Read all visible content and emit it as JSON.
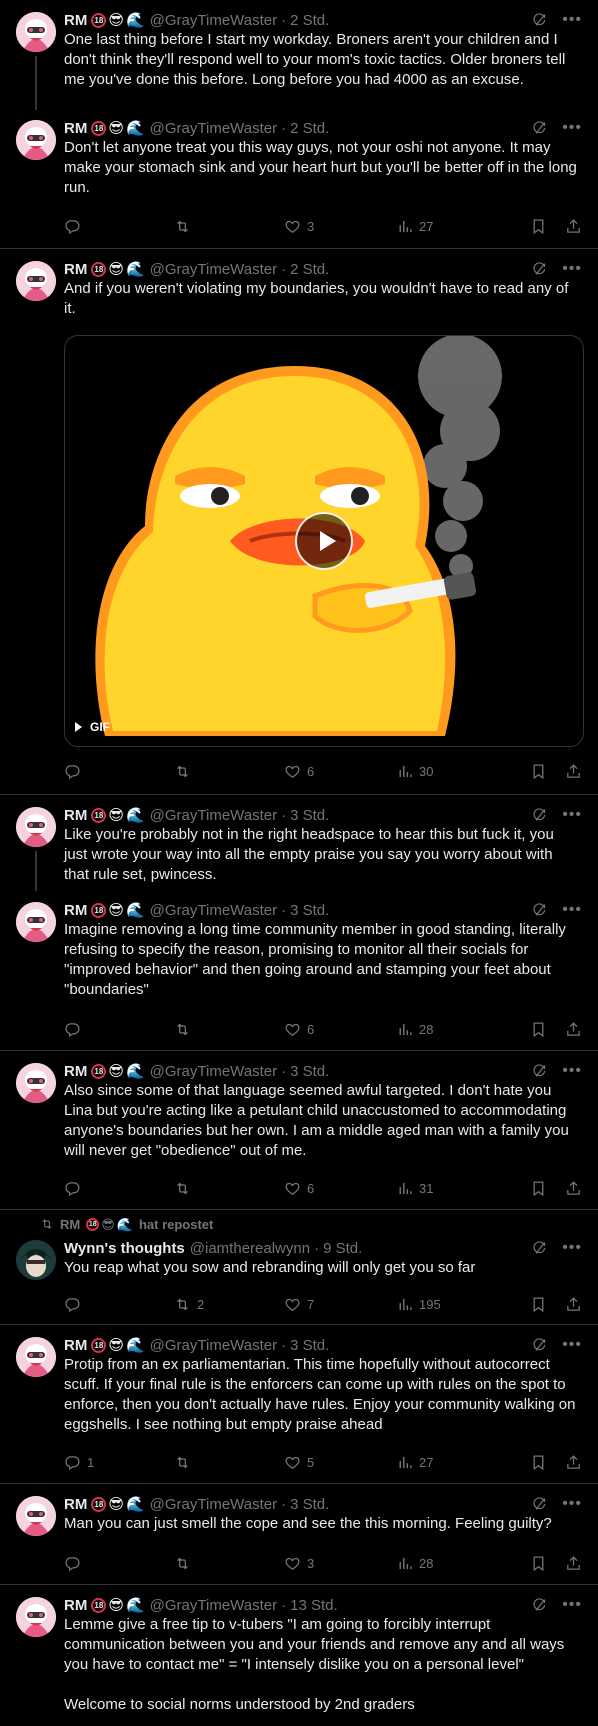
{
  "colors": {
    "background": "#000000",
    "text": "#e7e9ea",
    "muted": "#71767b",
    "border": "#2f3336",
    "accent": "#1d9bf0"
  },
  "icons": {
    "reply": "reply-icon",
    "repost": "repost-icon",
    "like": "heart-icon",
    "views": "views-icon",
    "bookmark": "bookmark-icon",
    "share": "share-icon",
    "grok": "grok-icon",
    "more": "more-icon"
  },
  "tweets": [
    {
      "name": "RM",
      "badges": [
        "18",
        "😎",
        "🌊"
      ],
      "handle": "@GrayTimeWaster",
      "time": "2 Std.",
      "text": "One last thing before I start my workday. Broners aren't your children and I don't think they'll respond well to your mom's toxic tactics. Older broners tell me you've done this before. Long before you had 4000 as an excuse."
    },
    {
      "name": "RM",
      "badges": [
        "18",
        "😎",
        "🌊"
      ],
      "handle": "@GrayTimeWaster",
      "time": "2 Std.",
      "text": "Don't let anyone treat you this way guys, not your oshi not anyone. It may make your stomach sink and your heart hurt but you'll be better off in the long run.",
      "stats": {
        "replies": "",
        "reposts": "",
        "likes": "3",
        "views": "27"
      }
    },
    {
      "name": "RM",
      "badges": [
        "18",
        "😎",
        "🌊"
      ],
      "handle": "@GrayTimeWaster",
      "time": "2 Std.",
      "text": "And if you weren't violating my boundaries, you wouldn't have to read any of it.",
      "media": {
        "type": "GIF",
        "label": "GIF"
      },
      "stats": {
        "replies": "",
        "reposts": "",
        "likes": "6",
        "views": "30"
      }
    },
    {
      "name": "RM",
      "badges": [
        "18",
        "😎",
        "🌊"
      ],
      "handle": "@GrayTimeWaster",
      "time": "3 Std.",
      "text": "Like you're probably not in the right headspace to hear this but fuck it, you just wrote your way into all the empty praise you say you worry about with that rule set, pwincess."
    },
    {
      "name": "RM",
      "badges": [
        "18",
        "😎",
        "🌊"
      ],
      "handle": "@GrayTimeWaster",
      "time": "3 Std.",
      "text": "Imagine removing a long time community member in good standing, literally refusing to specify the reason, promising to monitor all their socials for \"improved behavior\" and then going around and stamping your feet about \"boundaries\"",
      "stats": {
        "replies": "",
        "reposts": "",
        "likes": "6",
        "views": "28"
      }
    },
    {
      "name": "RM",
      "badges": [
        "18",
        "😎",
        "🌊"
      ],
      "handle": "@GrayTimeWaster",
      "time": "3 Std.",
      "text": "Also since some of that language seemed awful targeted. I don't hate you Lina but you're acting like a petulant child unaccustomed to accommodating anyone's boundaries but her own. I am a middle aged man with a family you will never get \"obedience\" out of me.",
      "stats": {
        "replies": "",
        "reposts": "",
        "likes": "6",
        "views": "31"
      }
    },
    {
      "repost_by": "RM",
      "repost_badges": [
        "18",
        "😎",
        "🌊"
      ],
      "repost_text": "hat repostet",
      "name": "Wynn's thoughts",
      "badges": [],
      "handle": "@iamtherealwynn",
      "time": "9 Std.",
      "text": "You reap what you sow and rebranding will only get you so far",
      "stats": {
        "replies": "",
        "reposts": "2",
        "likes": "7",
        "views": "195"
      }
    },
    {
      "name": "RM",
      "badges": [
        "18",
        "😎",
        "🌊"
      ],
      "handle": "@GrayTimeWaster",
      "time": "3 Std.",
      "text": "Protip from an ex parliamentarian. This time hopefully without autocorrect scuff. If your final rule is the enforcers can come up with rules on the spot to enforce, then you don't actually have rules. Enjoy your community walking on eggshells. I see nothing but empty praise ahead",
      "stats": {
        "replies": "1",
        "reposts": "",
        "likes": "5",
        "views": "27"
      }
    },
    {
      "name": "RM",
      "badges": [
        "18",
        "😎",
        "🌊"
      ],
      "handle": "@GrayTimeWaster",
      "time": "3 Std.",
      "text": "Man you can just smell the cope and see the this morning. Feeling guilty?",
      "stats": {
        "replies": "",
        "reposts": "",
        "likes": "3",
        "views": "28"
      }
    },
    {
      "name": "RM",
      "badges": [
        "18",
        "😎",
        "🌊"
      ],
      "handle": "@GrayTimeWaster",
      "time": "13 Std.",
      "text": "Lemme give a free tip to v-tubers \"I am going to forcibly interrupt communication between you and your friends and remove any and all ways you have to contact me\" = \"I intensely dislike you on a personal level\"\n\nWelcome to social norms understood by 2nd graders"
    }
  ]
}
